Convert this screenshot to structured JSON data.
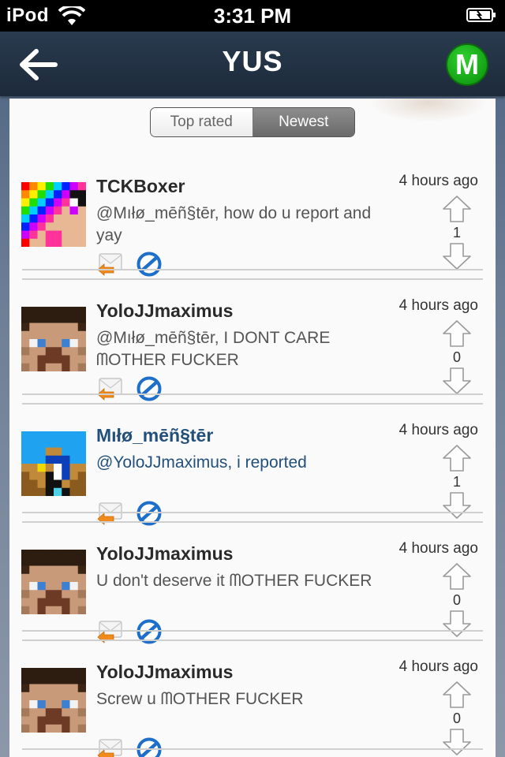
{
  "status_bar": {
    "carrier": "iPod",
    "time": "3:31 PM"
  },
  "nav": {
    "title": "YUS",
    "profile_initial": "M"
  },
  "tabs": [
    {
      "label": "Top rated",
      "selected": false
    },
    {
      "label": "Newest",
      "selected": true
    }
  ],
  "comments": [
    {
      "username": "TCKBoxer",
      "message": "@Mıłø_mēñ§tēr, how do u report and yay",
      "time": "4 hours ago",
      "score": "1",
      "avatar": "rainbow-avatar-icon",
      "highlight": false
    },
    {
      "username": "YoloJJmaximus",
      "message": "@Mıłø_mēñ§tēr, I DONT CARE ᗰOTHER FUCKER",
      "time": "4 hours ago",
      "score": "0",
      "avatar": "steve-avatar-icon",
      "highlight": false
    },
    {
      "username": "Mıłø_mēñ§tēr",
      "message": "@YoloJJmaximus, i reported",
      "time": "4 hours ago",
      "score": "1",
      "avatar": "blue-sky-avatar-icon",
      "highlight": true
    },
    {
      "username": "YoloJJmaximus",
      "message": "U don't deserve it ᗰOTHER FUCKER",
      "time": "4 hours ago",
      "score": "0",
      "avatar": "steve-avatar-icon",
      "highlight": false
    },
    {
      "username": "YoloJJmaximus",
      "message": "Screw u ᗰOTHER FUCKER",
      "time": "4 hours ago",
      "score": "0",
      "avatar": "steve-avatar-icon",
      "highlight": false
    }
  ],
  "colors": {
    "nav_bg": "#1c2a3a",
    "highlight_text": "#23507a",
    "profile_green": "#14a214",
    "block_blue": "#1e6fc9",
    "reply_orange": "#f08a1c"
  }
}
